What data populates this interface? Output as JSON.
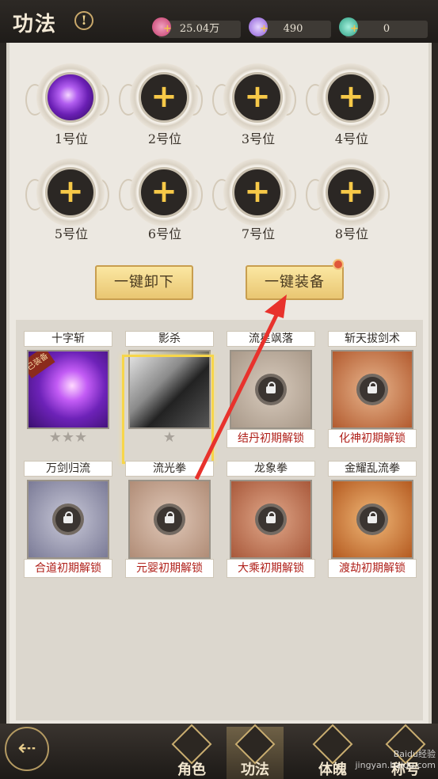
{
  "header": {
    "title": "功法",
    "info_symbol": "!",
    "resources": [
      {
        "icon": "red-crystal-icon",
        "value": "25.04万",
        "color": "#d9547a"
      },
      {
        "icon": "purple-crystal-icon",
        "value": "490",
        "color": "#9b6ad8"
      },
      {
        "icon": "jade-gem-icon",
        "value": "0",
        "color": "#3bb79a"
      }
    ]
  },
  "slots": [
    {
      "label": "1号位",
      "filled": true
    },
    {
      "label": "2号位",
      "filled": false
    },
    {
      "label": "3号位",
      "filled": false
    },
    {
      "label": "4号位",
      "filled": false
    },
    {
      "label": "5号位",
      "filled": false
    },
    {
      "label": "6号位",
      "filled": false
    },
    {
      "label": "7号位",
      "filled": false
    },
    {
      "label": "8号位",
      "filled": false
    }
  ],
  "plus_symbol": "+",
  "actions": {
    "unequip_all": "一键卸下",
    "equip_all": "一键装备"
  },
  "skills": [
    {
      "name": "十字斩",
      "status": "equipped",
      "badge": "已装备",
      "stars": "★★★",
      "art": "purple"
    },
    {
      "name": "影杀",
      "status": "selected",
      "stars": "★",
      "art": "shadow"
    },
    {
      "name": "流星飒落",
      "status": "locked",
      "unlock": "结丹初期解锁",
      "art": "#b8a89a"
    },
    {
      "name": "斩天拔剑术",
      "status": "locked",
      "unlock": "化神初期解锁",
      "art": "#c26a3c"
    },
    {
      "name": "万剑归流",
      "status": "locked",
      "unlock": "合道初期解锁",
      "art": "#8a8aa6"
    },
    {
      "name": "流光拳",
      "status": "locked",
      "unlock": "元婴初期解锁",
      "art": "#c9a48e"
    },
    {
      "name": "龙象拳",
      "status": "locked",
      "unlock": "大乘初期解锁",
      "art": "#c07a58"
    },
    {
      "name": "金耀乱流拳",
      "status": "locked",
      "unlock": "渡劫初期解锁",
      "art": "#c9702e"
    }
  ],
  "bottom_nav": {
    "back_symbol": "⇠",
    "tabs": [
      {
        "label": "角色",
        "active": false
      },
      {
        "label": "功法",
        "active": true
      },
      {
        "label": "体魄",
        "active": false
      },
      {
        "label": "称号",
        "active": false
      }
    ]
  },
  "watermark": "Baidu经验 jingyan.baidu.com"
}
